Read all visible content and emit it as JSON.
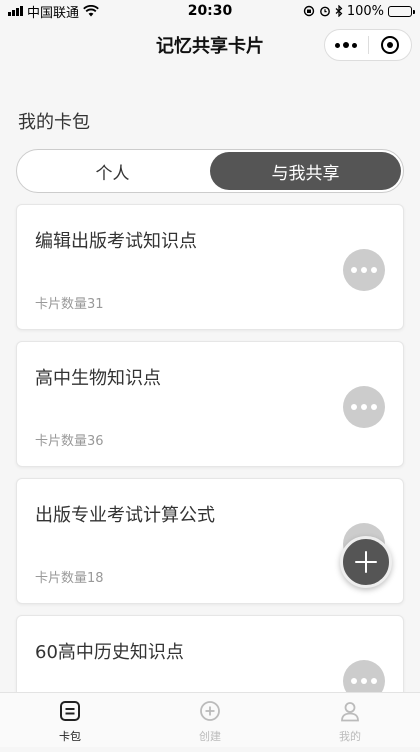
{
  "status_bar": {
    "carrier": "中国联通",
    "time": "20:30",
    "battery": "100%",
    "battery_level": 1.0
  },
  "nav": {
    "title": "记忆共享卡片"
  },
  "section_title": "我的卡包",
  "segment": {
    "options": [
      "个人",
      "与我共享"
    ],
    "active_index": 1
  },
  "cards": [
    {
      "title": "编辑出版考试知识点",
      "count": "卡片数量31"
    },
    {
      "title": "高中生物知识点",
      "count": "卡片数量36"
    },
    {
      "title": "出版专业考试计算公式",
      "count": "卡片数量18"
    },
    {
      "title": "60高中历史知识点",
      "count": ""
    }
  ],
  "tab_bar": {
    "items": [
      {
        "label": "卡包",
        "icon": "card-pack-icon",
        "active": true
      },
      {
        "label": "创建",
        "icon": "create-plus-icon",
        "active": false
      },
      {
        "label": "我的",
        "icon": "profile-icon",
        "active": false
      }
    ]
  },
  "colors": {
    "active_segment": "#555555",
    "fab": "#555555",
    "more_button": "#cccccc",
    "battery": "#3ac24a"
  }
}
